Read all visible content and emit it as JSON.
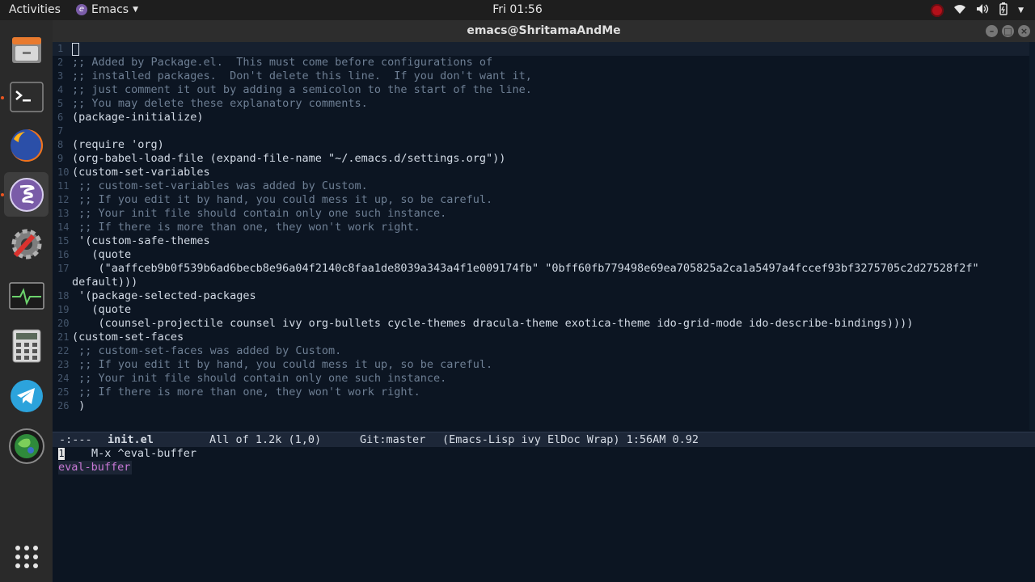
{
  "topbar": {
    "activities": "Activities",
    "app_name": "Emacs",
    "clock": "Fri 01:56"
  },
  "dock": {
    "items": [
      "files-icon",
      "terminal-icon",
      "firefox-icon",
      "emacs-icon",
      "settings-icon",
      "system-monitor-icon",
      "calculator-icon",
      "telegram-icon",
      "globe-app-icon",
      "show-applications-icon"
    ]
  },
  "window": {
    "title": "emacs@ShritamaAndMe"
  },
  "editor": {
    "lines": [
      {
        "n": "1",
        "text": "",
        "type": "code"
      },
      {
        "n": "2",
        "text": ";; Added by Package.el.  This must come before configurations of",
        "type": "comment"
      },
      {
        "n": "3",
        "text": ";; installed packages.  Don't delete this line.  If you don't want it,",
        "type": "comment"
      },
      {
        "n": "4",
        "text": ";; just comment it out by adding a semicolon to the start of the line.",
        "type": "comment"
      },
      {
        "n": "5",
        "text": ";; You may delete these explanatory comments.",
        "type": "comment"
      },
      {
        "n": "6",
        "text": "(package-initialize)",
        "type": "code"
      },
      {
        "n": "7",
        "text": "",
        "type": "code"
      },
      {
        "n": "8",
        "text": "(require 'org)",
        "type": "code"
      },
      {
        "n": "9",
        "text": "(org-babel-load-file (expand-file-name \"~/.emacs.d/settings.org\"))",
        "type": "code"
      },
      {
        "n": "10",
        "text": "(custom-set-variables",
        "type": "code"
      },
      {
        "n": "11",
        "text": " ;; custom-set-variables was added by Custom.",
        "type": "comment"
      },
      {
        "n": "12",
        "text": " ;; If you edit it by hand, you could mess it up, so be careful.",
        "type": "comment"
      },
      {
        "n": "13",
        "text": " ;; Your init file should contain only one such instance.",
        "type": "comment"
      },
      {
        "n": "14",
        "text": " ;; If there is more than one, they won't work right.",
        "type": "comment"
      },
      {
        "n": "15",
        "text": " '(custom-safe-themes",
        "type": "code"
      },
      {
        "n": "16",
        "text": "   (quote",
        "type": "code"
      },
      {
        "n": "17",
        "text": "    (\"aaffceb9b0f539b6ad6becb8e96a04f2140c8faa1de8039a343a4f1e009174fb\" \"0bff60fb779498e69ea705825a2ca1a5497a4fccef93bf3275705c2d27528f2f\"",
        "type": "code"
      },
      {
        "n": "",
        "text": "default)))",
        "type": "code"
      },
      {
        "n": "18",
        "text": " '(package-selected-packages",
        "type": "code"
      },
      {
        "n": "19",
        "text": "   (quote",
        "type": "code"
      },
      {
        "n": "20",
        "text": "    (counsel-projectile counsel ivy org-bullets cycle-themes dracula-theme exotica-theme ido-grid-mode ido-describe-bindings))))",
        "type": "code"
      },
      {
        "n": "21",
        "text": "(custom-set-faces",
        "type": "code"
      },
      {
        "n": "22",
        "text": " ;; custom-set-faces was added by Custom.",
        "type": "comment"
      },
      {
        "n": "23",
        "text": " ;; If you edit it by hand, you could mess it up, so be careful.",
        "type": "comment"
      },
      {
        "n": "24",
        "text": " ;; Your init file should contain only one such instance.",
        "type": "comment"
      },
      {
        "n": "25",
        "text": " ;; If there is more than one, they won't work right.",
        "type": "comment"
      },
      {
        "n": "26",
        "text": " )",
        "type": "code"
      }
    ]
  },
  "modeline": {
    "status": "-:---",
    "buffer": "init.el",
    "position": "All of 1.2k (1,0)",
    "vc": "Git:master",
    "modes": "(Emacs-Lisp ivy ElDoc Wrap) 1:56AM 0.92"
  },
  "minibuffer": {
    "count": "1",
    "prompt": "M-x ^eval-buffer",
    "match": "eval-buffer"
  }
}
